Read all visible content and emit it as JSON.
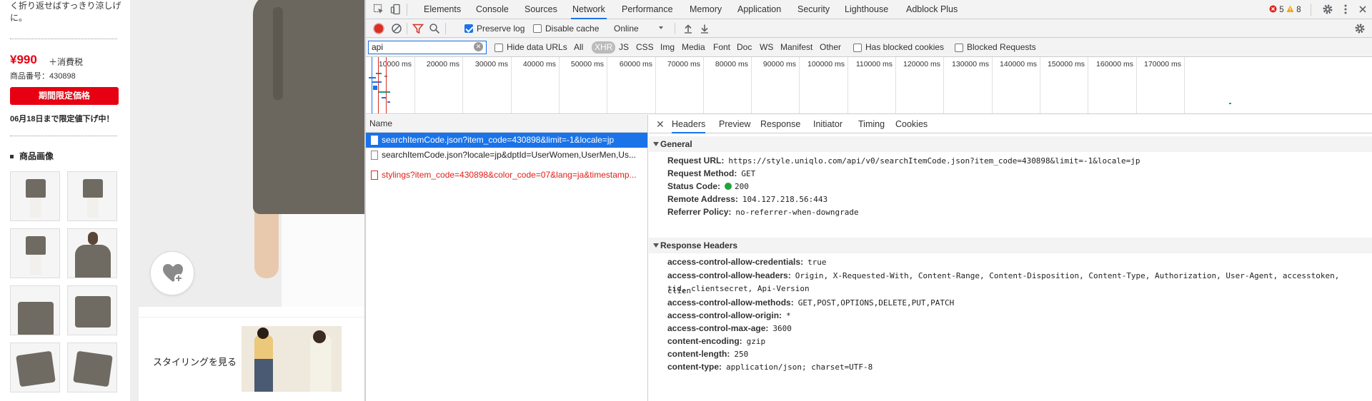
{
  "product": {
    "desc": "く折り返せばすっきり涼しげに。",
    "price": "¥990",
    "tax": "＋消費税",
    "sku": "商品番号：430898",
    "limited_label": "期間限定価格",
    "sale_note": "06月18日まで限定値下げ中！",
    "images_heading": "商品画像",
    "styling_label": "スタイリングを見る"
  },
  "devtools": {
    "tabs": [
      "Elements",
      "Console",
      "Sources",
      "Network",
      "Performance",
      "Memory",
      "Application",
      "Security",
      "Lighthouse",
      "Adblock Plus"
    ],
    "active_tab": "Network",
    "errors_count": "5",
    "warnings_count": "8",
    "toolbar": {
      "preserve_log": "Preserve log",
      "disable_cache": "Disable cache",
      "throttle": "Online"
    },
    "filter": {
      "value": "api",
      "hide_data_urls": "Hide data URLs",
      "types": [
        "All",
        "XHR",
        "JS",
        "CSS",
        "Img",
        "Media",
        "Font",
        "Doc",
        "WS",
        "Manifest",
        "Other"
      ],
      "active_type": "XHR",
      "has_blocked_cookies": "Has blocked cookies",
      "blocked_requests": "Blocked Requests"
    },
    "overview_ticks": [
      "10000 ms",
      "20000 ms",
      "30000 ms",
      "40000 ms",
      "50000 ms",
      "60000 ms",
      "70000 ms",
      "80000 ms",
      "90000 ms",
      "100000 ms",
      "110000 ms",
      "120000 ms",
      "130000 ms",
      "140000 ms",
      "150000 ms",
      "160000 ms",
      "170000 ms"
    ],
    "list_header": "Name",
    "requests": [
      "searchItemCode.json?item_code=430898&limit=-1&locale=jp",
      "searchItemCode.json?locale=jp&dptId=UserWomen,UserMen,Us...",
      "stylings?item_code=430898&color_code=07&lang=ja&timestamp..."
    ],
    "detail_tabs": [
      "Headers",
      "Preview",
      "Response",
      "Initiator",
      "Timing",
      "Cookies"
    ],
    "general": {
      "title": "General",
      "rows": [
        {
          "k": "Request URL:",
          "v": "https://style.uniqlo.com/api/v0/searchItemCode.json?item_code=430898&limit=-1&locale=jp"
        },
        {
          "k": "Request Method:",
          "v": "GET"
        },
        {
          "k": "Status Code:",
          "v": "200"
        },
        {
          "k": "Remote Address:",
          "v": "104.127.218.56:443"
        },
        {
          "k": "Referrer Policy:",
          "v": "no-referrer-when-downgrade"
        }
      ]
    },
    "response_headers": {
      "title": "Response Headers",
      "rows": [
        {
          "k": "access-control-allow-credentials:",
          "v": "true"
        },
        {
          "k": "access-control-allow-headers:",
          "v": "Origin, X-Requested-With, Content-Range, Content-Disposition, Content-Type, Authorization, User-Agent, accesstoken, clien"
        },
        {
          "k": "",
          "v": "tid, clientsecret, Api-Version"
        },
        {
          "k": "access-control-allow-methods:",
          "v": "GET,POST,OPTIONS,DELETE,PUT,PATCH"
        },
        {
          "k": "access-control-allow-origin:",
          "v": "*"
        },
        {
          "k": "access-control-max-age:",
          "v": "3600"
        },
        {
          "k": "content-encoding:",
          "v": "gzip"
        },
        {
          "k": "content-length:",
          "v": "250"
        },
        {
          "k": "content-type:",
          "v": "application/json; charset=UTF-8"
        }
      ]
    }
  }
}
